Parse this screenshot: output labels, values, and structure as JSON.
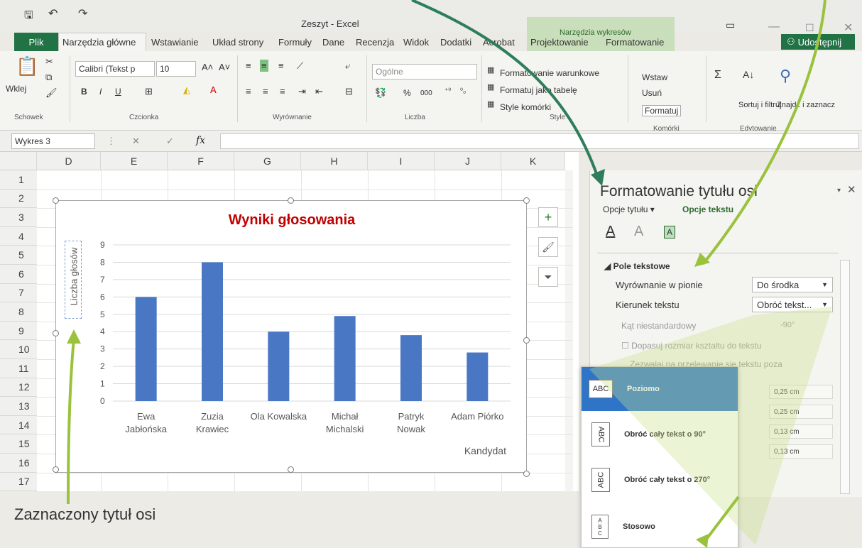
{
  "window": {
    "title": "Zeszyt - Excel",
    "context_tab_group": "Narzędzia wykresów"
  },
  "tabs": [
    "Plik",
    "Narzędzia główne",
    "Wstawianie",
    "Układ strony",
    "Formuły",
    "Dane",
    "Recenzja",
    "Widok",
    "Dodatki",
    "Acrobat",
    "Projektowanie",
    "Formatowanie"
  ],
  "share_button": "Udostępnij",
  "ribbon": {
    "paste": "Wklej",
    "clipboard_group": "Schowek",
    "font_name": "Calibri (Tekst p",
    "font_size": "10",
    "bold": "B",
    "italic": "I",
    "underline": "U",
    "font_group": "Czcionka",
    "alignment_group": "Wyrównanie",
    "number_format": "Ogólne",
    "percent": "%",
    "thousands": "000",
    "number_group": "Liczba",
    "cond_format": "Formatowanie warunkowe",
    "format_as_table": "Formatuj jako tabelę",
    "cell_styles": "Style komórki",
    "styles_group": "Style",
    "insert": "Wstaw",
    "delete": "Usuń",
    "format": "Formatuj",
    "cells_group": "Komórki",
    "sort_filter": "Sortuj i filtruj",
    "find_select": "Znajdź i zaznacz",
    "editing_group": "Edytowanie"
  },
  "formula_bar": {
    "name_box": "Wykres 3",
    "fx": "fx"
  },
  "columns": [
    "D",
    "E",
    "F",
    "G",
    "H",
    "I",
    "J",
    "K"
  ],
  "rows": [
    "1",
    "2",
    "3",
    "4",
    "5",
    "6",
    "7",
    "8",
    "9",
    "10",
    "11",
    "12",
    "13",
    "14",
    "15",
    "16",
    "17"
  ],
  "chart_data": {
    "type": "bar",
    "title": "Wyniki głosowania",
    "xlabel": "Kandydat",
    "ylabel": "Liczba głosów",
    "categories_line1": [
      "Ewa",
      "Zuzia",
      "Ola Kowalska",
      "Michał",
      "Patryk",
      "Adam Piórko"
    ],
    "categories_line2": [
      "Jabłońska",
      "Krawiec",
      "",
      "Michalski",
      "Nowak",
      ""
    ],
    "values": [
      6,
      8,
      4,
      4.9,
      3.8,
      2.8
    ],
    "yticks": [
      "0",
      "1",
      "2",
      "3",
      "4",
      "5",
      "6",
      "7",
      "8",
      "9"
    ],
    "ylim": [
      0,
      9
    ],
    "bar_color": "#4a77c4",
    "title_color": "#c00000"
  },
  "pane": {
    "title": "Formatowanie tytułu osi",
    "tab_title_options": "Opcje tytułu",
    "tab_text_options": "Opcje tekstu",
    "section": "Pole tekstowe",
    "vertical_alignment_label": "Wyrównanie w pionie",
    "vertical_alignment_value": "Do środka",
    "text_direction_label": "Kierunek tekstu",
    "text_direction_value": "Obróć tekst...",
    "custom_angle_label": "Kąt niestandardowy",
    "custom_angle_value": "-90°",
    "autofit_label": "Dopasuj rozmiar kształtu do tekstu",
    "wrap_label": "Zezwalaj na przelewanie się tekstu poza",
    "margins": [
      "0,25 cm",
      "0,25 cm",
      "0,13 cm",
      "0,13 cm"
    ]
  },
  "dropdown": {
    "options": [
      {
        "icon": "ABC",
        "label": "Poziomo"
      },
      {
        "icon": "ABC",
        "label": "Obróć cały tekst o 90°"
      },
      {
        "icon": "ABC",
        "label": "Obróć cały tekst o 270°"
      },
      {
        "icon": "ABC",
        "label": "Stosowo"
      }
    ]
  },
  "caption": "Zaznaczony tytuł osi"
}
